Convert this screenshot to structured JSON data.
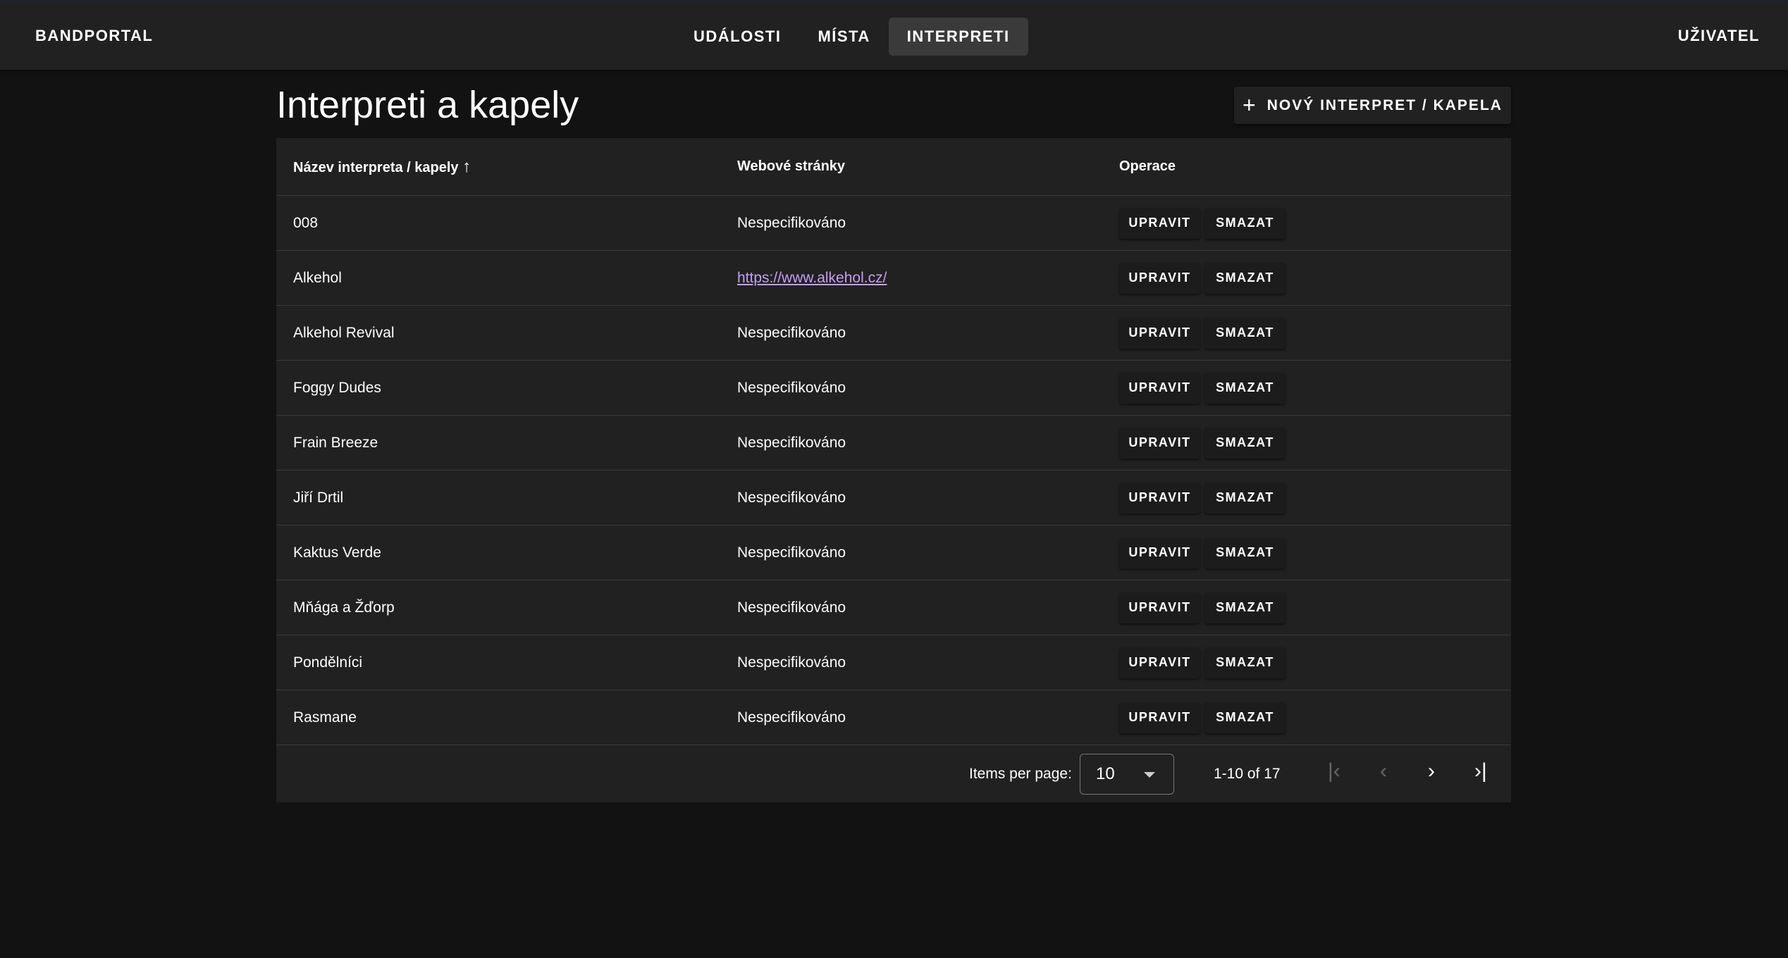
{
  "header": {
    "brand": "BANDPORTAL",
    "nav": [
      "UDÁLOSTI",
      "MÍSTA",
      "INTERPRETI"
    ],
    "active": "INTERPRETI",
    "user": "UŽIVATEL"
  },
  "page": {
    "title": "Interpreti a kapely",
    "new_button": "NOVÝ INTERPRET / KAPELA"
  },
  "table": {
    "columns": [
      "Název interpreta / kapely",
      "Webové stránky",
      "Operace"
    ],
    "sort_icon": "arrow-up-icon",
    "edit_label": "UPRAVIT",
    "delete_label": "SMAZAT",
    "rows": [
      {
        "name": "008",
        "web": "Nespecifikováno"
      },
      {
        "name": "Alkehol",
        "web": "https://www.alkehol.cz/"
      },
      {
        "name": "Alkehol Revival",
        "web": "Nespecifikováno"
      },
      {
        "name": "Foggy Dudes",
        "web": "Nespecifikováno"
      },
      {
        "name": "Frain Breeze",
        "web": "Nespecifikováno"
      },
      {
        "name": "Jiří Drtil",
        "web": "Nespecifikováno"
      },
      {
        "name": "Kaktus Verde",
        "web": "Nespecifikováno"
      },
      {
        "name": "Mňága a Žďorp",
        "web": "Nespecifikováno"
      },
      {
        "name": "Pondělníci",
        "web": "Nespecifikováno"
      },
      {
        "name": "Rasmane",
        "web": "Nespecifikováno"
      }
    ]
  },
  "paginator": {
    "items_per_page_label": "Items per page:",
    "page_size": "10",
    "range": "1-10 of 17"
  },
  "colors": {
    "link": "#c79ef5",
    "surface": "#212121",
    "background": "#121212"
  }
}
